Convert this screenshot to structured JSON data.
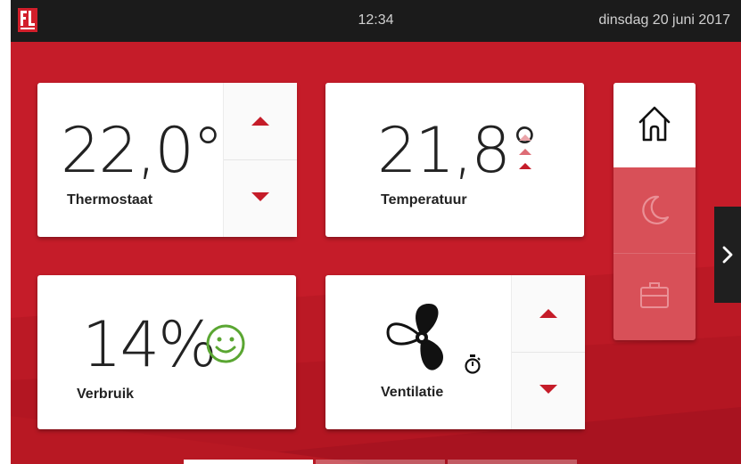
{
  "status_bar": {
    "time": "12:34",
    "date": "dinsdag 20 juni 2017",
    "logo_icon": "fl-logo-icon"
  },
  "tiles": {
    "thermostat": {
      "value": "22,0°",
      "label": "Thermostaat",
      "increase_icon": "triangle-up-icon",
      "decrease_icon": "triangle-down-icon"
    },
    "temperature": {
      "value": "21,8°",
      "label": "Temperatuur",
      "trend_icon": "rising-trend-icon"
    },
    "consumption": {
      "value": "14%",
      "label": "Verbruik",
      "status_icon": "smiley-icon"
    },
    "ventilation": {
      "label": "Ventilatie",
      "fan_icon": "fan-icon",
      "timer_icon": "stopwatch-icon",
      "increase_icon": "triangle-up-icon",
      "decrease_icon": "triangle-down-icon"
    }
  },
  "modes": [
    {
      "name": "home",
      "icon": "house-icon",
      "active": true
    },
    {
      "name": "night",
      "icon": "moon-icon",
      "active": false
    },
    {
      "name": "away",
      "icon": "briefcase-icon",
      "active": false
    }
  ],
  "navigation": {
    "next_icon": "chevron-right-icon",
    "pages": 3,
    "active_page": 1
  },
  "colors": {
    "accent": "#c51c29",
    "positive": "#5aa632",
    "tile_bg": "#ffffff",
    "top_bar": "#1b1b1b"
  }
}
